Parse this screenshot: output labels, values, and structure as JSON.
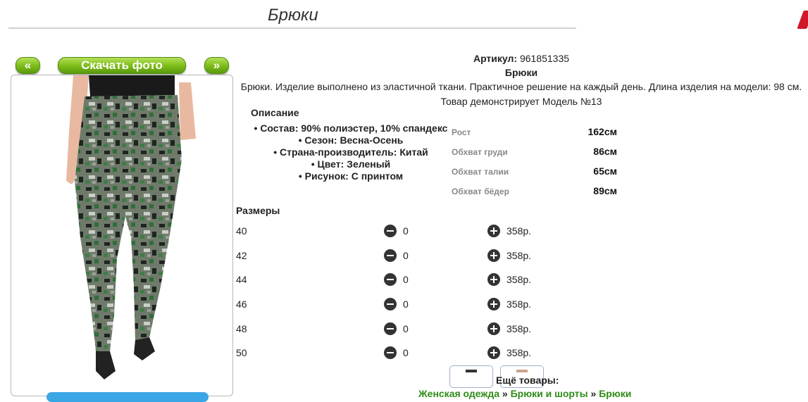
{
  "page": {
    "title": "Брюки"
  },
  "gallery": {
    "prev_label": "«",
    "download_label": "Скачать фото",
    "next_label": "»"
  },
  "product": {
    "article_label": "Артикул:",
    "article_value": "961851335",
    "name": "Брюки",
    "description": "Брюки. Изделие выполнено из эластичной ткани. Практичное решение на каждый день. Длина изделия на модели: 98 см.",
    "model_note": "Товар демонстрирует Модель №13",
    "description_heading": "Описание",
    "features": [
      "• Состав: 90% полиэстер, 10% спандекс",
      "• Сезон: Весна-Осень",
      "• Страна-производитель: Китай",
      "• Цвет: Зеленый",
      "• Рисунок: С принтом"
    ],
    "measurements": [
      {
        "label": "Рост",
        "value": "162см"
      },
      {
        "label": "Обхват груди",
        "value": "86см"
      },
      {
        "label": "Обхват талии",
        "value": "65см"
      },
      {
        "label": "Обхват бёдер",
        "value": "89см"
      }
    ]
  },
  "sizes": {
    "heading": "Размеры",
    "rows": [
      {
        "size": "40",
        "qty": "0",
        "price": "358р."
      },
      {
        "size": "42",
        "qty": "0",
        "price": "358р."
      },
      {
        "size": "44",
        "qty": "0",
        "price": "358р."
      },
      {
        "size": "46",
        "qty": "0",
        "price": "358р."
      },
      {
        "size": "48",
        "qty": "0",
        "price": "358р."
      },
      {
        "size": "50",
        "qty": "0",
        "price": "358р."
      }
    ]
  },
  "more": {
    "label": "Ещё товары:",
    "breadcrumbs": [
      "Женская одежда",
      "Брюки и шорты",
      "Брюки"
    ],
    "separator": "»"
  }
}
